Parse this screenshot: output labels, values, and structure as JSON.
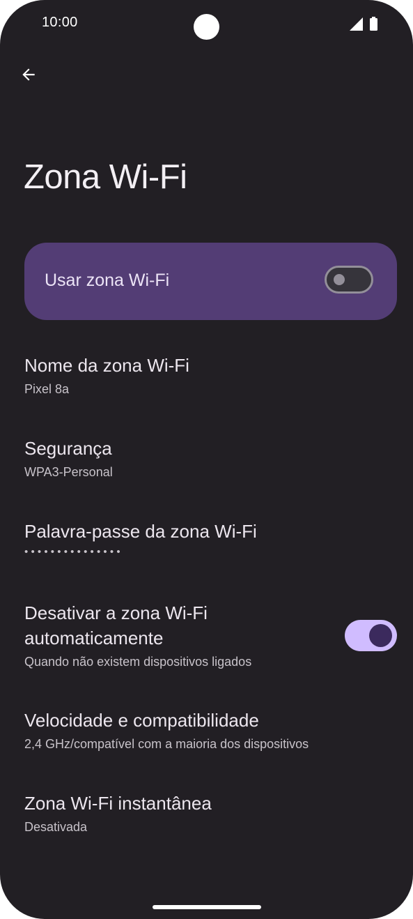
{
  "status_bar": {
    "time": "10:00",
    "icons": [
      "camera-cutout",
      "signal-icon",
      "battery-icon"
    ]
  },
  "nav": {
    "back_icon": "arrow-back-icon"
  },
  "page": {
    "title": "Zona Wi-Fi"
  },
  "main_toggle": {
    "label": "Usar zona Wi-Fi",
    "state": "off"
  },
  "settings": [
    {
      "title": "Nome da zona Wi-Fi",
      "summary": "Pixel 8a"
    },
    {
      "title": "Segurança",
      "summary": "WPA3-Personal"
    },
    {
      "title": "Palavra-passe da zona Wi-Fi",
      "summary": "•••••••••••••••"
    },
    {
      "title_line1": "Desativar a zona Wi-Fi",
      "title_line2": "automaticamente",
      "summary": "Quando não existem dispositivos ligados",
      "toggle_state": "on"
    },
    {
      "title": "Velocidade e compatibilidade",
      "summary": "2,4 GHz/compatível com a maioria dos dispositivos"
    },
    {
      "title": "Zona Wi-Fi instantânea",
      "summary": "Desativada"
    }
  ],
  "colors": {
    "background": "#221f24",
    "card": "#533d75",
    "switch_on_track": "#d0bcff",
    "switch_on_thumb": "#3b2a5d",
    "switch_off_outline": "#938f99"
  }
}
